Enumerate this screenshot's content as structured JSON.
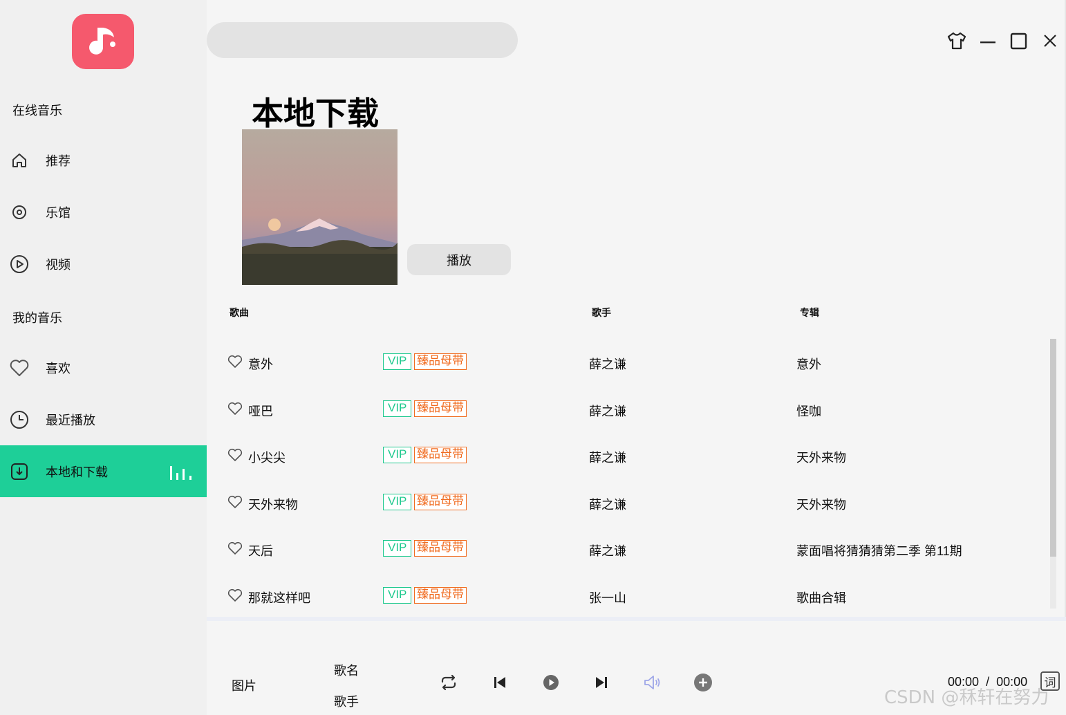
{
  "sidebar": {
    "section_online": "在线音乐",
    "section_mine": "我的音乐",
    "items": [
      {
        "label": "推荐",
        "icon": "home-icon"
      },
      {
        "label": "乐馆",
        "icon": "disc-icon"
      },
      {
        "label": "视频",
        "icon": "play-circle-icon"
      },
      {
        "label": "喜欢",
        "icon": "heart-icon"
      },
      {
        "label": "最近播放",
        "icon": "clock-icon"
      },
      {
        "label": "本地和下载",
        "icon": "download-icon",
        "active": true
      }
    ]
  },
  "search": {
    "placeholder": ""
  },
  "main": {
    "title": "本地下载",
    "play_label": "播放",
    "columns": {
      "song": "歌曲",
      "artist": "歌手",
      "album": "专辑"
    },
    "badges": {
      "vip": "VIP",
      "master": "臻品母带"
    },
    "songs": [
      {
        "title": "意外",
        "artist": "薛之谦",
        "album": "意外"
      },
      {
        "title": "哑巴",
        "artist": "薛之谦",
        "album": "怪咖"
      },
      {
        "title": "小尖尖",
        "artist": "薛之谦",
        "album": "天外来物"
      },
      {
        "title": "天外来物",
        "artist": "薛之谦",
        "album": "天外来物"
      },
      {
        "title": "天后",
        "artist": "薛之谦",
        "album": "蒙面唱将猜猜猜第二季 第11期"
      },
      {
        "title": "那就这样吧",
        "artist": "张一山",
        "album": "歌曲合辑"
      }
    ]
  },
  "player": {
    "picture_label": "图片",
    "song_label": "歌名",
    "artist_label": "歌手",
    "current_time": "00:00",
    "separator": "/",
    "total_time": "00:00",
    "lyric_label": "词"
  },
  "watermark": "CSDN @秝轩在努力",
  "colors": {
    "accent": "#1ecf98",
    "logo": "#f5596d",
    "vip": "#1ec98e",
    "master": "#f06b1f"
  }
}
